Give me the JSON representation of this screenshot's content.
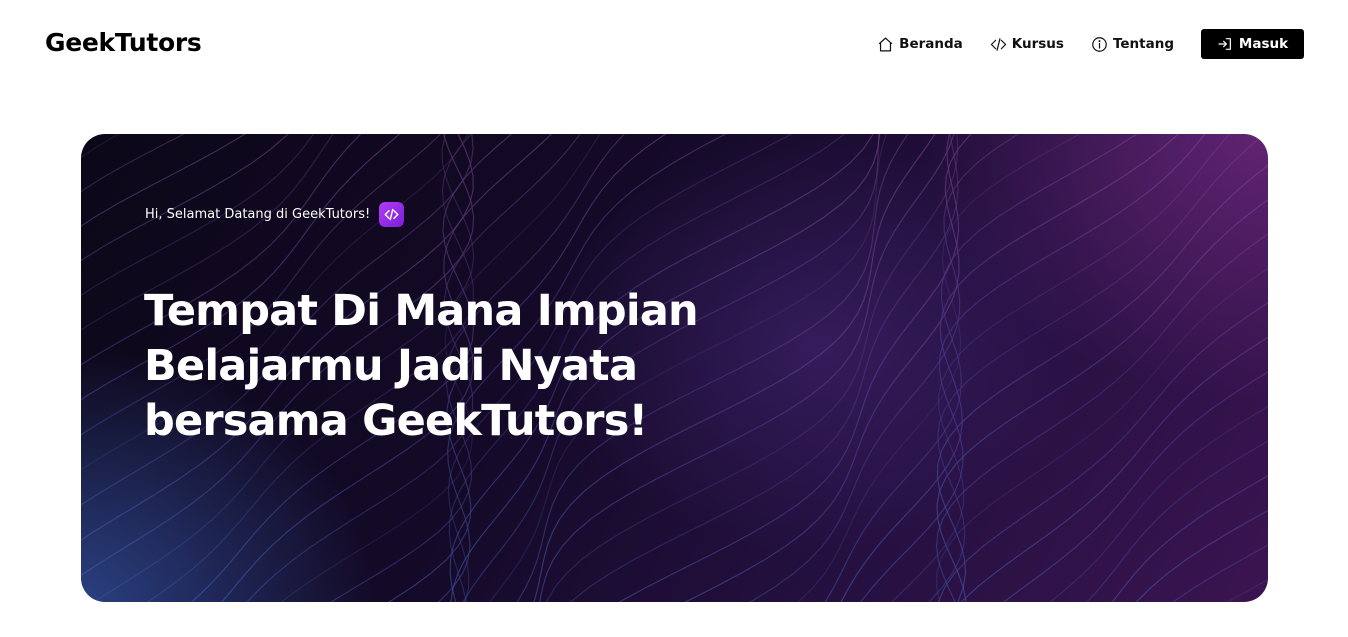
{
  "brand": {
    "name": "GeekTutors"
  },
  "nav": {
    "items": [
      {
        "label": "Beranda",
        "icon": "home-icon"
      },
      {
        "label": "Kursus",
        "icon": "code-icon"
      },
      {
        "label": "Tentang",
        "icon": "info-icon"
      }
    ],
    "login": {
      "label": "Masuk",
      "icon": "login-icon"
    }
  },
  "hero": {
    "greeting": "Hi, Selamat Datang di GeekTutors!",
    "badge_icon": "code-icon",
    "headline_lines": [
      "Tempat Di Mana Impian",
      "Belajarmu Jadi Nyata",
      "bersama GeekTutors!"
    ]
  },
  "colors": {
    "background": "#ffffff",
    "text": "#000000",
    "button_bg": "#000000",
    "button_text": "#ffffff",
    "hero_dark": "#140a28",
    "hero_blue": "#406ed2",
    "hero_purple": "#8c3296",
    "badge": "#9a2de8"
  }
}
